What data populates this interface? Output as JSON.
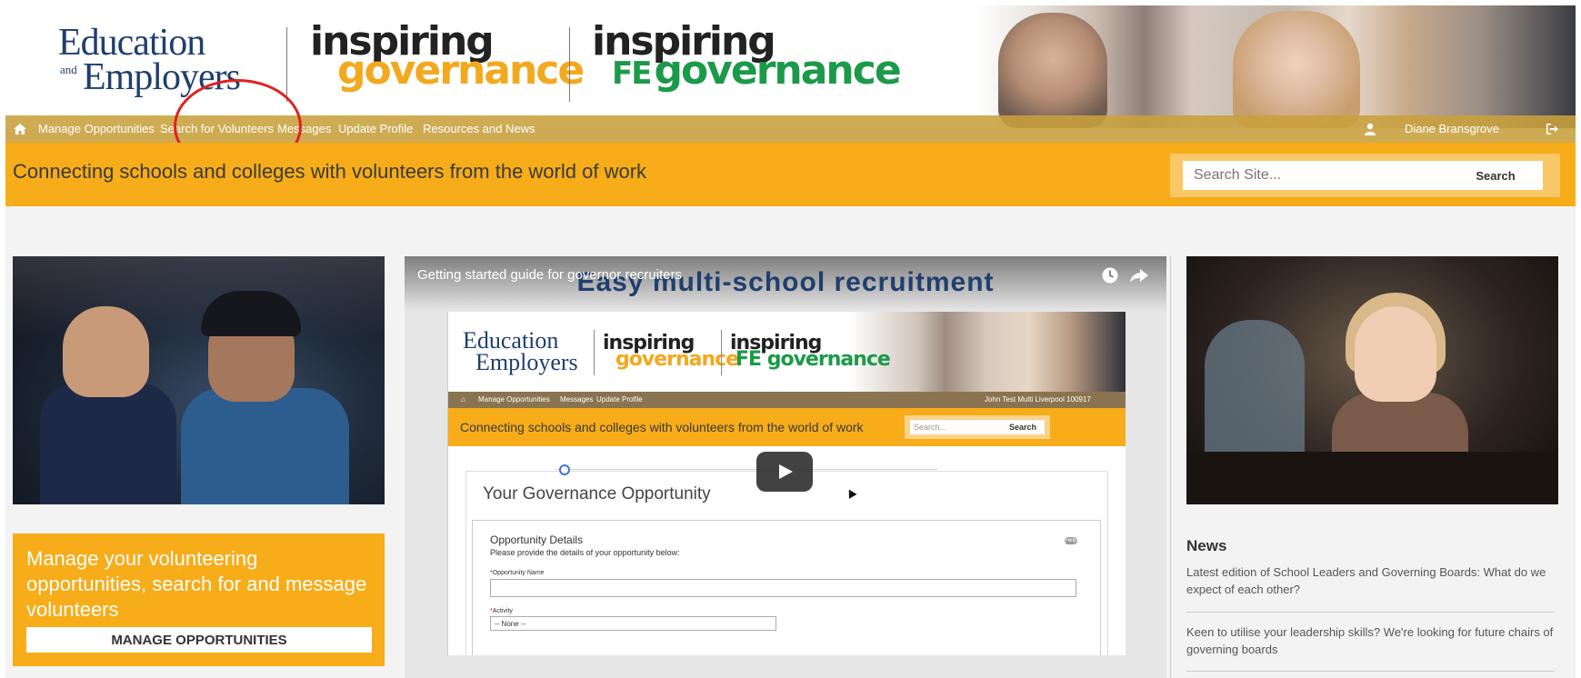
{
  "header": {
    "logo_education": {
      "line1": "Education",
      "and": "and",
      "line2": "Employers"
    },
    "logo_inspiring_governance": {
      "line1": "inspiring",
      "line2": "governance"
    },
    "logo_inspiring_fe": {
      "line1": "inspiring",
      "fe": "FE",
      "line2": "governance"
    }
  },
  "nav": {
    "home_icon": "home-icon",
    "items": [
      "Manage Opportunities",
      "Search for Volunteers",
      "Messages",
      "Update Profile",
      "Resources and News"
    ],
    "user_name": "Diane Bransgrove",
    "user_icon": "user-icon",
    "logout_icon": "logout-icon"
  },
  "banner": {
    "tagline": "Connecting schools and colleges with volunteers from the world of work",
    "search_placeholder": "Search Site...",
    "search_button": "Search"
  },
  "manage_box": {
    "text": "Manage your volunteering opportunities, search for and message volunteers",
    "button": "MANAGE OPPORTUNITIES"
  },
  "video": {
    "title": "Getting started guide for governor recruiters",
    "overlay_title": "Easy multi-school recruitment",
    "mock": {
      "nav": [
        "Manage Opportunities",
        "Messages",
        "Update Profile"
      ],
      "user": "John Test Multi Liverpool 100917",
      "tagline": "Connecting schools and colleges with volunteers from the world of work",
      "search_placeholder": "Search...",
      "search_button": "Search",
      "form_title": "Your Governance Opportunity",
      "section_title": "Opportunity Details",
      "section_sub": "Please provide the details of your opportunity below:",
      "help": "Help",
      "field1_label": "Opportunity Name",
      "field2_label": "Activity",
      "field2_value": "-- None --"
    }
  },
  "news": {
    "heading": "News",
    "items": [
      "Latest edition of School Leaders and Governing Boards: What do we expect of each other?",
      "Keen to utilise your leadership skills? We're looking for future chairs of governing boards"
    ]
  },
  "colors": {
    "accent": "#f7ac19",
    "navy": "#1f3f6e",
    "green": "#1c9a4a",
    "annotation": "#e02020"
  }
}
